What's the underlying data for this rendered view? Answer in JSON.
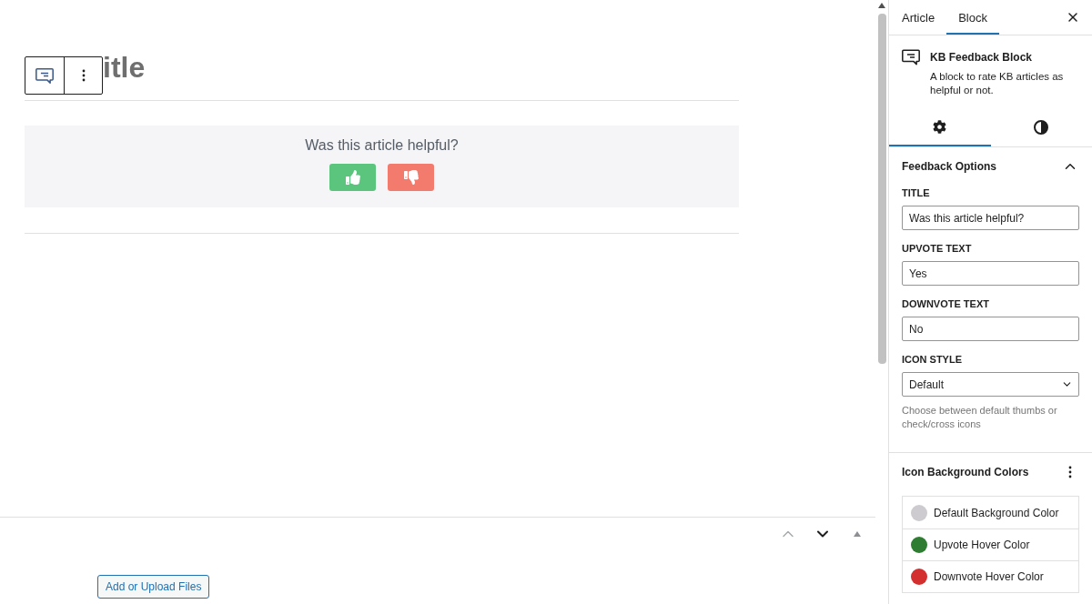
{
  "editor": {
    "title": "itle",
    "feedback_block": {
      "question": "Was this article helpful?",
      "vote_buttons": [
        {
          "kind": "upvote",
          "color": "#5bc57e"
        },
        {
          "kind": "downvote",
          "color": "#f27b6d"
        }
      ]
    },
    "mover_buttons": [
      {
        "kind": "up",
        "disabled": true
      },
      {
        "kind": "down",
        "disabled": false
      }
    ],
    "upload_button": "Add or Upload Files"
  },
  "sidebar": {
    "tabs": [
      {
        "label": "Article",
        "selected": false
      },
      {
        "label": "Block",
        "selected": true
      }
    ],
    "block_card": {
      "name": "KB Feedback Block",
      "description": "A block to rate KB articles as helpful or not."
    },
    "inspector_tabs": [
      {
        "kind": "settings",
        "selected": true
      },
      {
        "kind": "styles",
        "selected": false
      }
    ],
    "feedback_options": {
      "title": "Feedback Options",
      "expanded": true,
      "fields": [
        {
          "kind": "text",
          "label": "TITLE",
          "value": "Was this article helpful?"
        },
        {
          "kind": "text",
          "label": "UPVOTE TEXT",
          "value": "Yes"
        },
        {
          "kind": "text",
          "label": "DOWNVOTE TEXT",
          "value": "No"
        },
        {
          "kind": "select",
          "label": "ICON STYLE",
          "value": "Default",
          "help": "Choose between default thumbs or check/cross icons"
        }
      ]
    },
    "icon_background_colors": {
      "title": "Icon Background Colors",
      "colors": [
        {
          "label": "Default Background Color",
          "color": "#cdcbcf"
        },
        {
          "label": "Upvote Hover Color",
          "color": "#2e7d32"
        },
        {
          "label": "Downvote Hover Color",
          "color": "#d32f2f"
        }
      ]
    }
  }
}
